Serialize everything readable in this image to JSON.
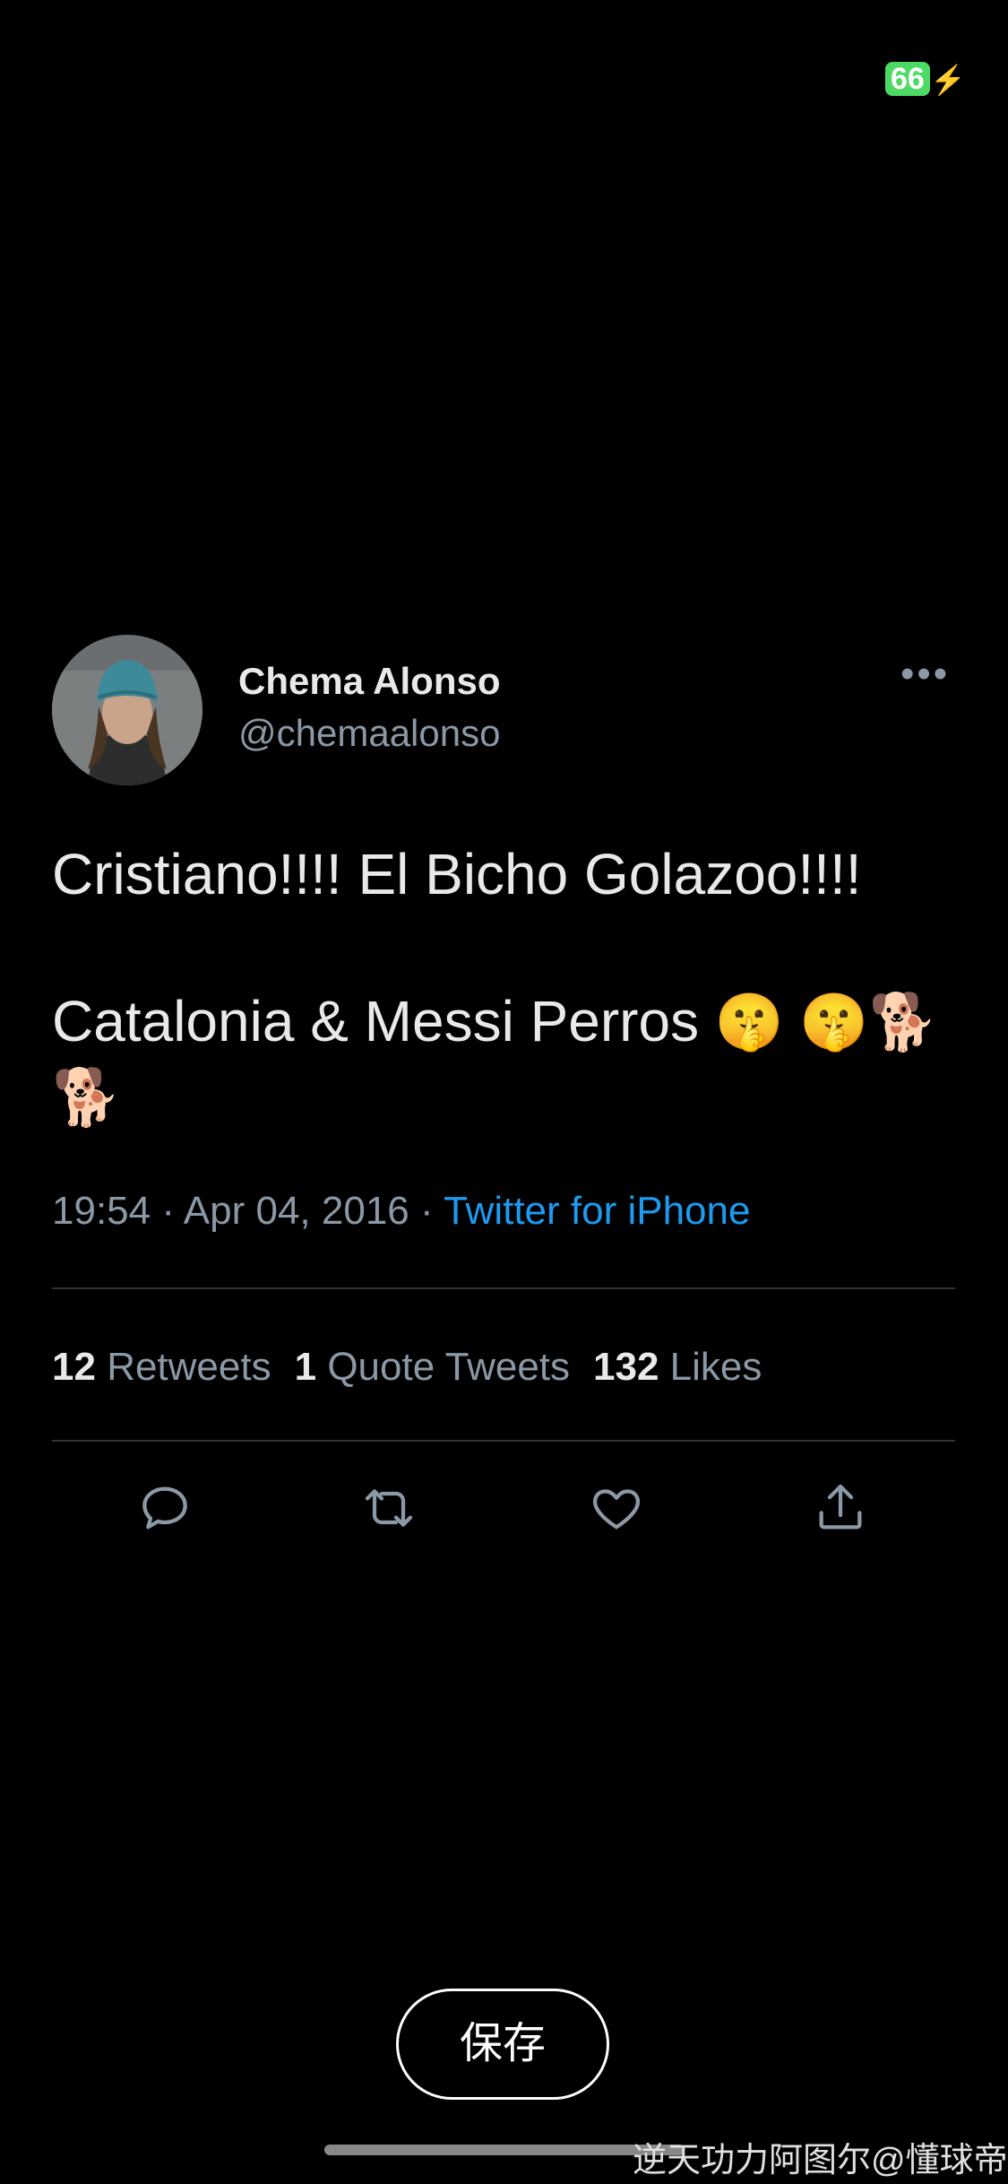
{
  "status_bar": {
    "battery": "66"
  },
  "tweet": {
    "author_name": "Chema Alonso",
    "handle": "@chemaalonso",
    "text_line1": "Cristiano!!!! El Bicho Golazoo!!!!",
    "text_line2": "Catalonia & Messi Perros",
    "emojis": "🤫 🤫🐕🐕",
    "time": "19:54",
    "date": "Apr 04, 2016",
    "source": "Twitter for iPhone",
    "separator": "·",
    "stats": {
      "retweets_count": "12",
      "retweets_label": "Retweets",
      "quotes_count": "1",
      "quotes_label": "Quote Tweets",
      "likes_count": "132",
      "likes_label": "Likes"
    }
  },
  "icons": {
    "more": "more-options-icon",
    "reply": "reply-icon",
    "retweet": "retweet-icon",
    "like": "heart-icon",
    "share": "share-icon"
  },
  "save_button": {
    "label": "保存"
  },
  "watermark": "逆天功力阿图尔@懂球帝"
}
